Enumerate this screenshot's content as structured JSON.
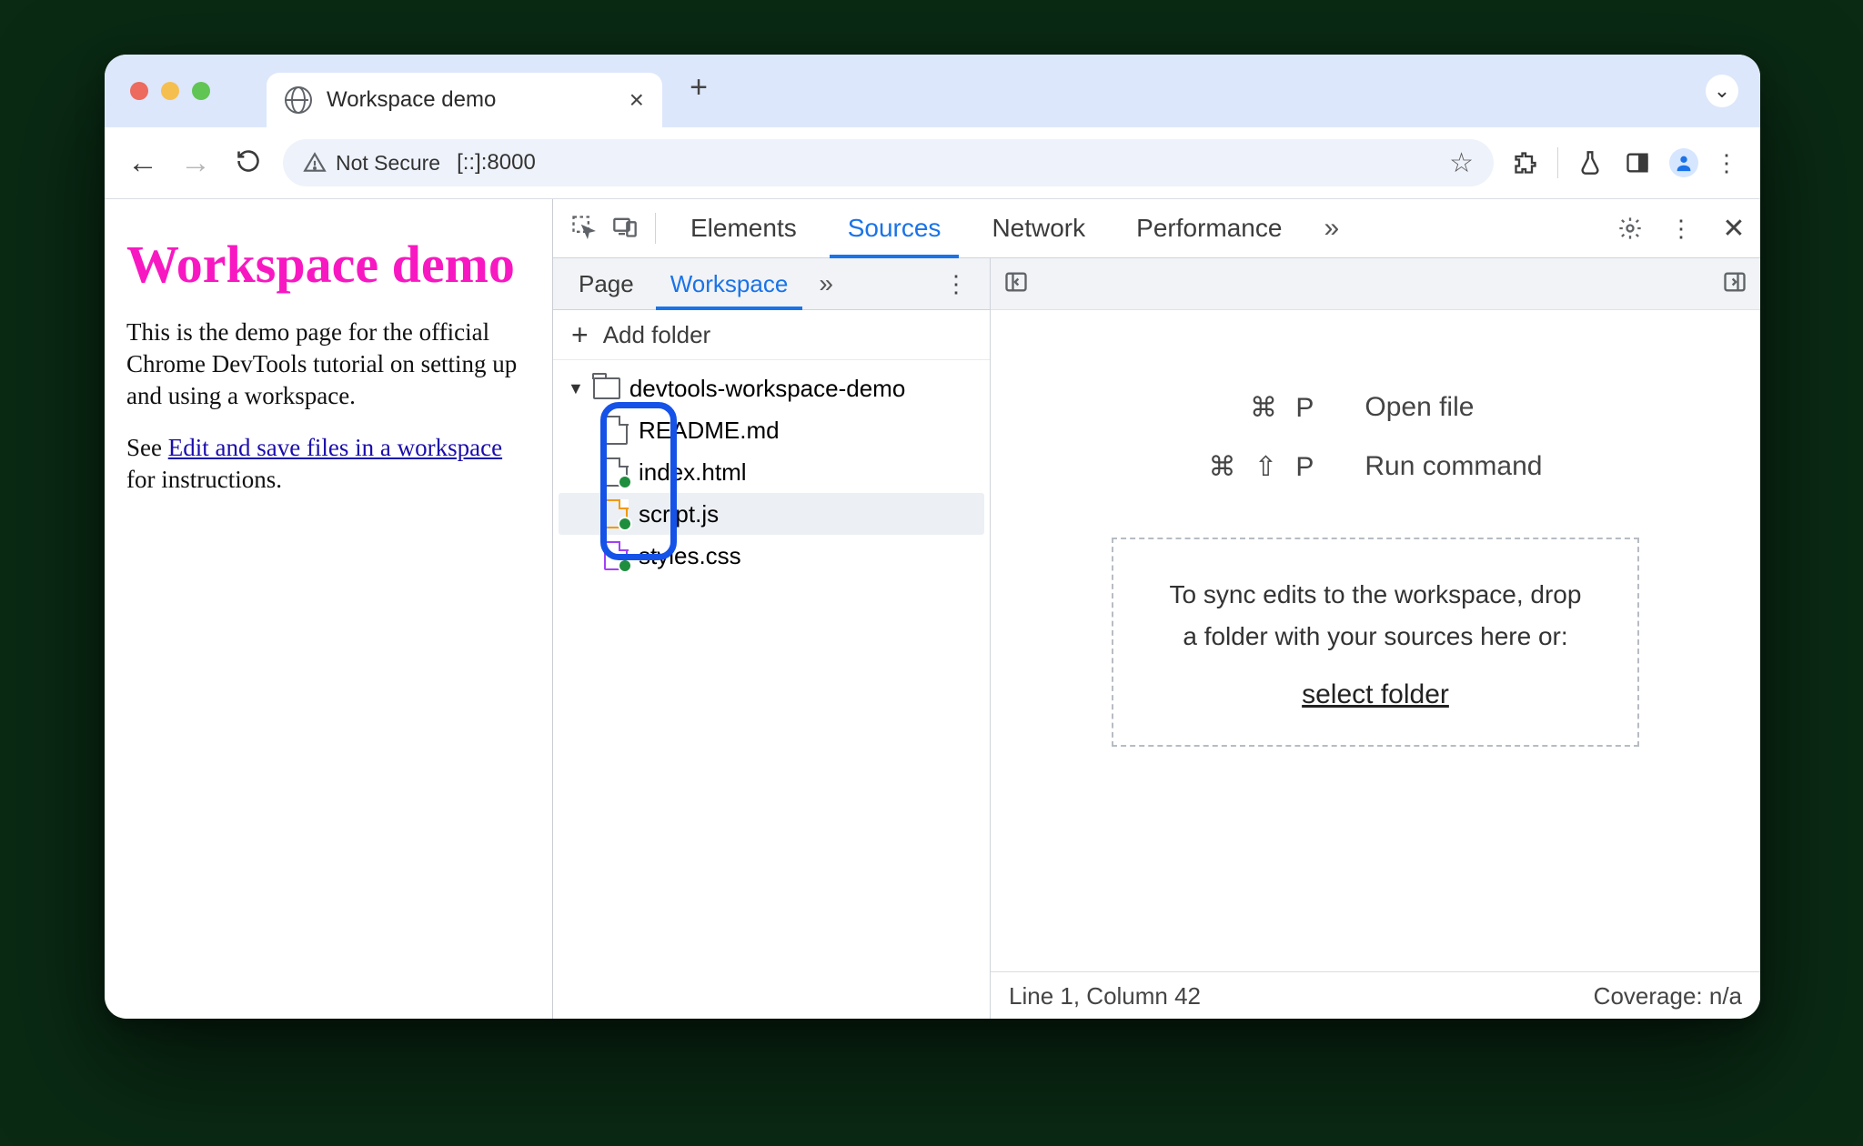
{
  "browser": {
    "tab_title": "Workspace demo",
    "security_label": "Not Secure",
    "url": "[::]:8000"
  },
  "page": {
    "heading": "Workspace demo",
    "para1": "This is the demo page for the official Chrome DevTools tutorial on setting up and using a workspace.",
    "para2_pre": "See ",
    "para2_link": "Edit and save files in a workspace",
    "para2_post": " for instructions."
  },
  "devtools": {
    "tabs": {
      "elements": "Elements",
      "sources": "Sources",
      "network": "Network",
      "performance": "Performance"
    },
    "sources_tabs": {
      "page": "Page",
      "workspace": "Workspace"
    },
    "add_folder": "Add folder",
    "folder_name": "devtools-workspace-demo",
    "files": {
      "readme": "README.md",
      "index": "index.html",
      "script": "script.js",
      "styles": "styles.css"
    },
    "shortcuts": {
      "open_key": "⌘  P",
      "open_label": "Open file",
      "run_key": "⌘  ⇧  P",
      "run_label": "Run command"
    },
    "dropzone": {
      "line": "To sync edits to the workspace, drop a folder with your sources here or:",
      "link": "select folder"
    },
    "status": {
      "left": "Line 1, Column 42",
      "right": "Coverage: n/a"
    }
  }
}
